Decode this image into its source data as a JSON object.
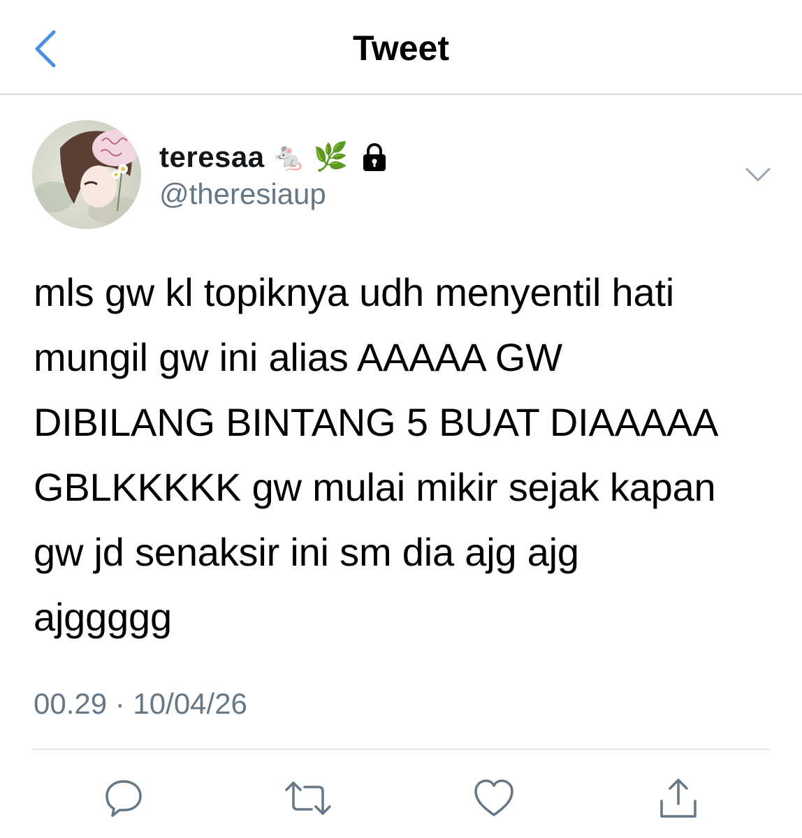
{
  "header": {
    "title": "Tweet",
    "back_icon": "chevron-left-icon",
    "accent_color": "#4a90e2"
  },
  "author": {
    "display_name": "teresaa",
    "emojis": [
      "🐁",
      "🌿"
    ],
    "protected_icon": "lock-icon",
    "handle": "@theresiaup",
    "menu_icon": "chevron-down-icon"
  },
  "tweet": {
    "text": "mls gw kl topiknya udh menyentil hati\nmungil gw ini alias AAAAA GW\nDIBILANG BINTANG 5 BUAT DIAAAAA\nGBLKKKKK gw mulai mikir sejak kapan\ngw jd senaksir ini sm dia ajg ajg\najggggg",
    "timestamp": "00.29 · 10/04/26"
  },
  "actions": [
    {
      "name": "reply",
      "icon": "reply-icon"
    },
    {
      "name": "retweet",
      "icon": "retweet-icon"
    },
    {
      "name": "like",
      "icon": "heart-icon"
    },
    {
      "name": "share",
      "icon": "share-icon"
    }
  ],
  "colors": {
    "secondary_text": "#657786",
    "icon_gray": "#657786",
    "divider": "#e1e8ed"
  }
}
